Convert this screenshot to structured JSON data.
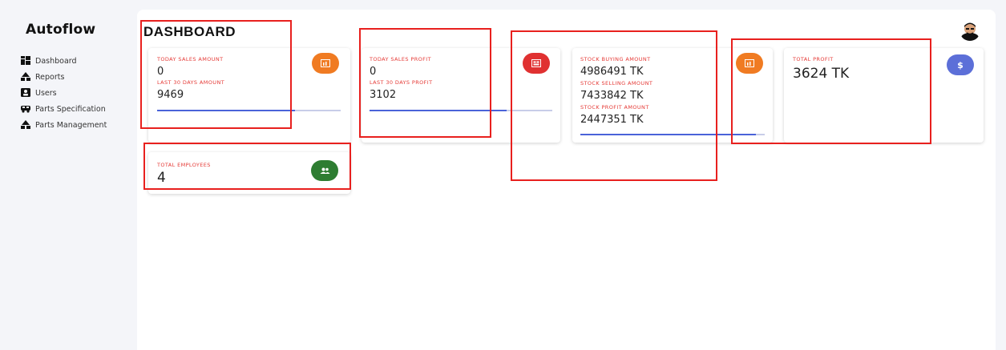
{
  "app": {
    "brand": "Autoflow"
  },
  "sidebar": {
    "items": [
      {
        "label": "Dashboard",
        "icon": "dashboard-icon"
      },
      {
        "label": "Reports",
        "icon": "reports-icon"
      },
      {
        "label": "Users",
        "icon": "users-icon"
      },
      {
        "label": "Parts Specification",
        "icon": "car-icon"
      },
      {
        "label": "Parts Management",
        "icon": "parts-icon"
      }
    ]
  },
  "header": {
    "title": "DASHBOARD"
  },
  "cards": {
    "sales": {
      "label1": "TODAY SALES AMOUNT",
      "value1": "0",
      "label2": "LAST 30 DAYS AMOUNT",
      "value2": "9469",
      "icon": "chart-icon",
      "icon_color": "#f07b22",
      "progress": 0.75
    },
    "profit": {
      "label1": "TODAY SALES PROFIT",
      "value1": "0",
      "label2": "LAST 30 DAYS PROFIT",
      "value2": "3102",
      "icon": "receipt-icon",
      "icon_color": "#e03131",
      "progress": 0.75
    },
    "stock": {
      "label1": "STOCK BUYING AMOUNT",
      "value1": "4986491 TK",
      "label2": "STOCK SELLING AMOUNT",
      "value2": "7433842 TK",
      "label3": "STOCK PROFIT AMOUNT",
      "value3": "2447351 TK",
      "icon": "chart-icon",
      "icon_color": "#f07b22",
      "progress": 0.95
    },
    "total_profit": {
      "label1": "TOTAL PROFIT",
      "value1": "3624 TK",
      "icon_symbol": "$",
      "icon": "dollar-icon",
      "icon_color": "#5c6fd8"
    },
    "employees": {
      "label1": "TOTAL EMPLOYEES",
      "value1": "4",
      "icon": "group-icon",
      "icon_color": "#2e7d32"
    }
  },
  "colors": {
    "label_red": "#e53935",
    "progress_blue": "#4a63d9",
    "highlight_red": "#e8201e"
  }
}
